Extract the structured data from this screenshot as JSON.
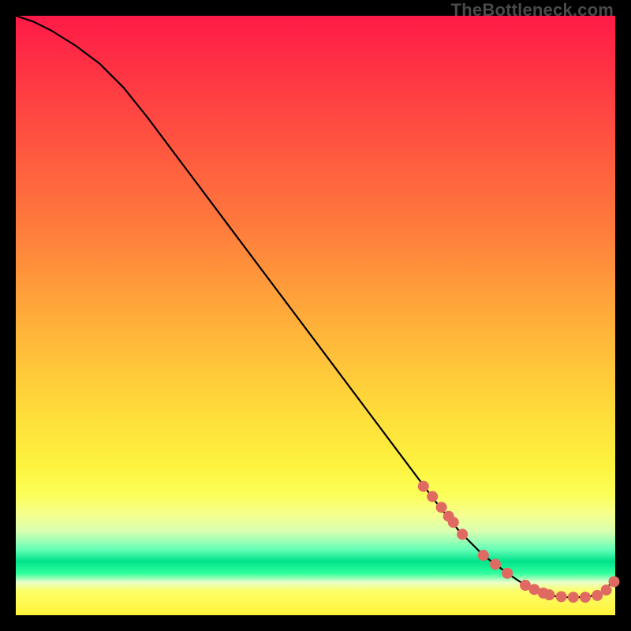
{
  "watermark": "TheBottleneck.com",
  "chart_data": {
    "type": "line",
    "title": "",
    "xlabel": "",
    "ylabel": "",
    "xlim": [
      0,
      100
    ],
    "ylim": [
      0,
      100
    ],
    "grid": false,
    "series": [
      {
        "name": "curve",
        "x": [
          0,
          3,
          6,
          10,
          14,
          18,
          22,
          28,
          34,
          40,
          46,
          52,
          58,
          64,
          70,
          74,
          78,
          82,
          85,
          88,
          91,
          94,
          96,
          98,
          100
        ],
        "y": [
          100,
          99,
          97.5,
          95,
          92,
          88,
          83,
          75,
          67,
          59,
          51,
          43,
          35,
          27,
          19,
          14,
          10,
          7,
          5,
          3.5,
          3,
          3,
          3.2,
          4,
          6
        ]
      }
    ],
    "markers": {
      "name": "highlight-points",
      "color": "#e06a62",
      "radius_px": 7,
      "x": [
        68,
        69.5,
        71,
        72.2,
        73,
        74.5,
        78,
        80,
        82,
        85,
        86.5,
        88,
        89,
        91,
        93,
        95,
        97,
        98.5,
        99.8
      ],
      "y": [
        21.5,
        19.8,
        18,
        16.5,
        15.5,
        13.5,
        10,
        8.5,
        7,
        5,
        4.3,
        3.7,
        3.4,
        3.1,
        3.0,
        3.0,
        3.3,
        4.2,
        5.6
      ]
    }
  }
}
